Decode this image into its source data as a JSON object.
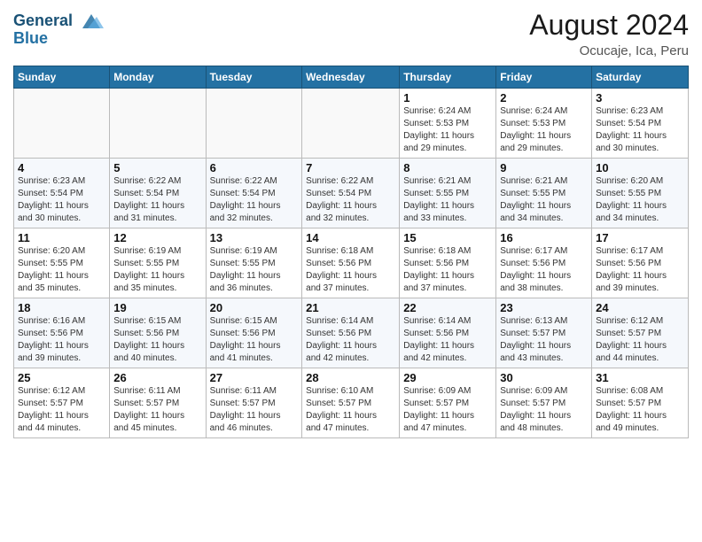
{
  "header": {
    "logo_line1": "General",
    "logo_line2": "Blue",
    "month_year": "August 2024",
    "location": "Ocucaje, Ica, Peru"
  },
  "weekdays": [
    "Sunday",
    "Monday",
    "Tuesday",
    "Wednesday",
    "Thursday",
    "Friday",
    "Saturday"
  ],
  "weeks": [
    [
      {
        "day": "",
        "info": ""
      },
      {
        "day": "",
        "info": ""
      },
      {
        "day": "",
        "info": ""
      },
      {
        "day": "",
        "info": ""
      },
      {
        "day": "1",
        "info": "Sunrise: 6:24 AM\nSunset: 5:53 PM\nDaylight: 11 hours\nand 29 minutes."
      },
      {
        "day": "2",
        "info": "Sunrise: 6:24 AM\nSunset: 5:53 PM\nDaylight: 11 hours\nand 29 minutes."
      },
      {
        "day": "3",
        "info": "Sunrise: 6:23 AM\nSunset: 5:54 PM\nDaylight: 11 hours\nand 30 minutes."
      }
    ],
    [
      {
        "day": "4",
        "info": "Sunrise: 6:23 AM\nSunset: 5:54 PM\nDaylight: 11 hours\nand 30 minutes."
      },
      {
        "day": "5",
        "info": "Sunrise: 6:22 AM\nSunset: 5:54 PM\nDaylight: 11 hours\nand 31 minutes."
      },
      {
        "day": "6",
        "info": "Sunrise: 6:22 AM\nSunset: 5:54 PM\nDaylight: 11 hours\nand 32 minutes."
      },
      {
        "day": "7",
        "info": "Sunrise: 6:22 AM\nSunset: 5:54 PM\nDaylight: 11 hours\nand 32 minutes."
      },
      {
        "day": "8",
        "info": "Sunrise: 6:21 AM\nSunset: 5:55 PM\nDaylight: 11 hours\nand 33 minutes."
      },
      {
        "day": "9",
        "info": "Sunrise: 6:21 AM\nSunset: 5:55 PM\nDaylight: 11 hours\nand 34 minutes."
      },
      {
        "day": "10",
        "info": "Sunrise: 6:20 AM\nSunset: 5:55 PM\nDaylight: 11 hours\nand 34 minutes."
      }
    ],
    [
      {
        "day": "11",
        "info": "Sunrise: 6:20 AM\nSunset: 5:55 PM\nDaylight: 11 hours\nand 35 minutes."
      },
      {
        "day": "12",
        "info": "Sunrise: 6:19 AM\nSunset: 5:55 PM\nDaylight: 11 hours\nand 35 minutes."
      },
      {
        "day": "13",
        "info": "Sunrise: 6:19 AM\nSunset: 5:55 PM\nDaylight: 11 hours\nand 36 minutes."
      },
      {
        "day": "14",
        "info": "Sunrise: 6:18 AM\nSunset: 5:56 PM\nDaylight: 11 hours\nand 37 minutes."
      },
      {
        "day": "15",
        "info": "Sunrise: 6:18 AM\nSunset: 5:56 PM\nDaylight: 11 hours\nand 37 minutes."
      },
      {
        "day": "16",
        "info": "Sunrise: 6:17 AM\nSunset: 5:56 PM\nDaylight: 11 hours\nand 38 minutes."
      },
      {
        "day": "17",
        "info": "Sunrise: 6:17 AM\nSunset: 5:56 PM\nDaylight: 11 hours\nand 39 minutes."
      }
    ],
    [
      {
        "day": "18",
        "info": "Sunrise: 6:16 AM\nSunset: 5:56 PM\nDaylight: 11 hours\nand 39 minutes."
      },
      {
        "day": "19",
        "info": "Sunrise: 6:15 AM\nSunset: 5:56 PM\nDaylight: 11 hours\nand 40 minutes."
      },
      {
        "day": "20",
        "info": "Sunrise: 6:15 AM\nSunset: 5:56 PM\nDaylight: 11 hours\nand 41 minutes."
      },
      {
        "day": "21",
        "info": "Sunrise: 6:14 AM\nSunset: 5:56 PM\nDaylight: 11 hours\nand 42 minutes."
      },
      {
        "day": "22",
        "info": "Sunrise: 6:14 AM\nSunset: 5:56 PM\nDaylight: 11 hours\nand 42 minutes."
      },
      {
        "day": "23",
        "info": "Sunrise: 6:13 AM\nSunset: 5:57 PM\nDaylight: 11 hours\nand 43 minutes."
      },
      {
        "day": "24",
        "info": "Sunrise: 6:12 AM\nSunset: 5:57 PM\nDaylight: 11 hours\nand 44 minutes."
      }
    ],
    [
      {
        "day": "25",
        "info": "Sunrise: 6:12 AM\nSunset: 5:57 PM\nDaylight: 11 hours\nand 44 minutes."
      },
      {
        "day": "26",
        "info": "Sunrise: 6:11 AM\nSunset: 5:57 PM\nDaylight: 11 hours\nand 45 minutes."
      },
      {
        "day": "27",
        "info": "Sunrise: 6:11 AM\nSunset: 5:57 PM\nDaylight: 11 hours\nand 46 minutes."
      },
      {
        "day": "28",
        "info": "Sunrise: 6:10 AM\nSunset: 5:57 PM\nDaylight: 11 hours\nand 47 minutes."
      },
      {
        "day": "29",
        "info": "Sunrise: 6:09 AM\nSunset: 5:57 PM\nDaylight: 11 hours\nand 47 minutes."
      },
      {
        "day": "30",
        "info": "Sunrise: 6:09 AM\nSunset: 5:57 PM\nDaylight: 11 hours\nand 48 minutes."
      },
      {
        "day": "31",
        "info": "Sunrise: 6:08 AM\nSunset: 5:57 PM\nDaylight: 11 hours\nand 49 minutes."
      }
    ]
  ]
}
